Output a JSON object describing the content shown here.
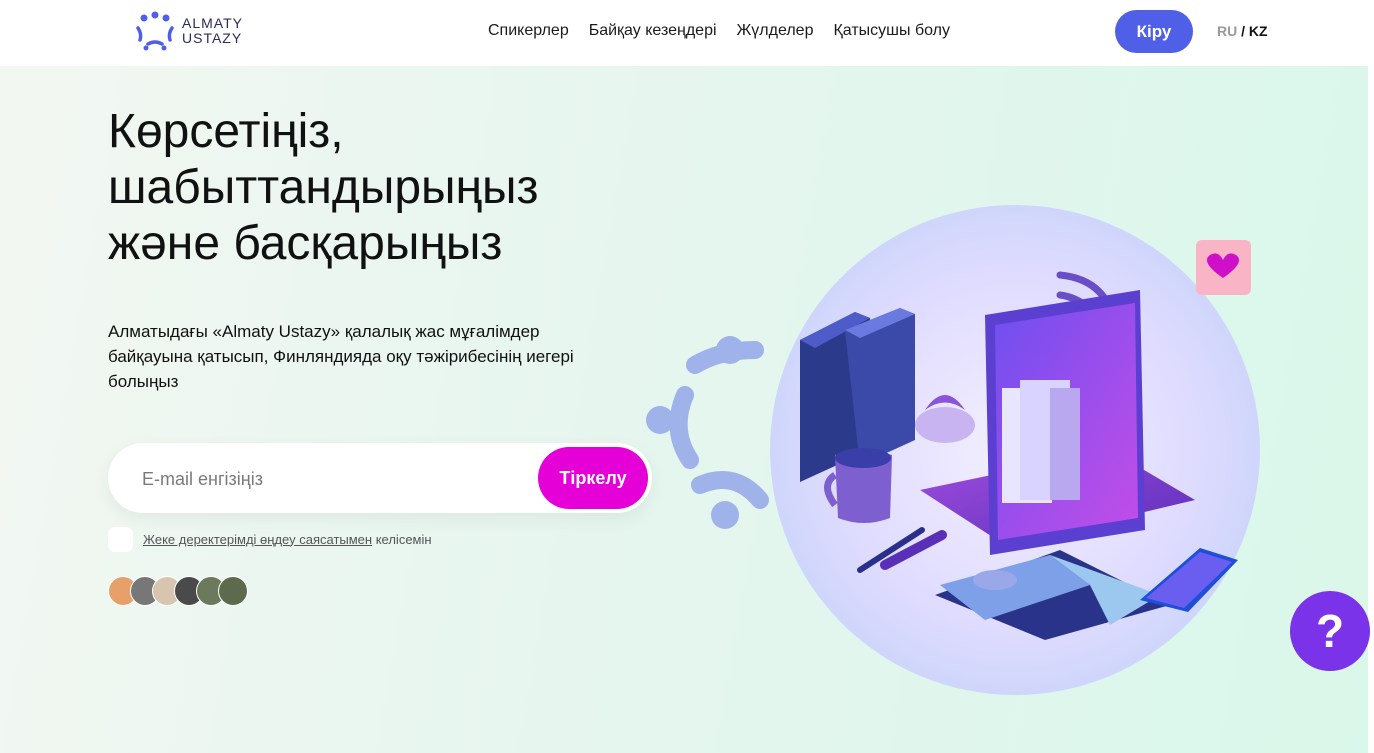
{
  "header": {
    "logo_line1": "ALMATY",
    "logo_line2": "USTAZY",
    "nav": [
      "Спикерлер",
      "Байқау кезеңдері",
      "Жүлделер",
      "Қатысушы болу"
    ],
    "login_label": "Кіру",
    "lang_ru": "RU",
    "lang_sep": "/",
    "lang_kz": "KZ"
  },
  "hero": {
    "title": "Көрсетіңіз, шабыттандырыңыз және басқарыңыз",
    "description": "Алматыдағы «Almaty Ustazy» қалалық жас мұғалімдер байқауына қатысып, Финляндияда оқу тәжірибесінің иегері болыңыз",
    "email_placeholder": "E-mail енгізіңіз",
    "register_label": "Тіркелу",
    "consent_link": "Жеке деректерімді өңдеу саясатымен",
    "consent_text": "келісемін",
    "help_label": "?"
  },
  "colors": {
    "accent_blue": "#4f5fe8",
    "accent_magenta": "#e600d8",
    "help_purple": "#7a33e8"
  }
}
